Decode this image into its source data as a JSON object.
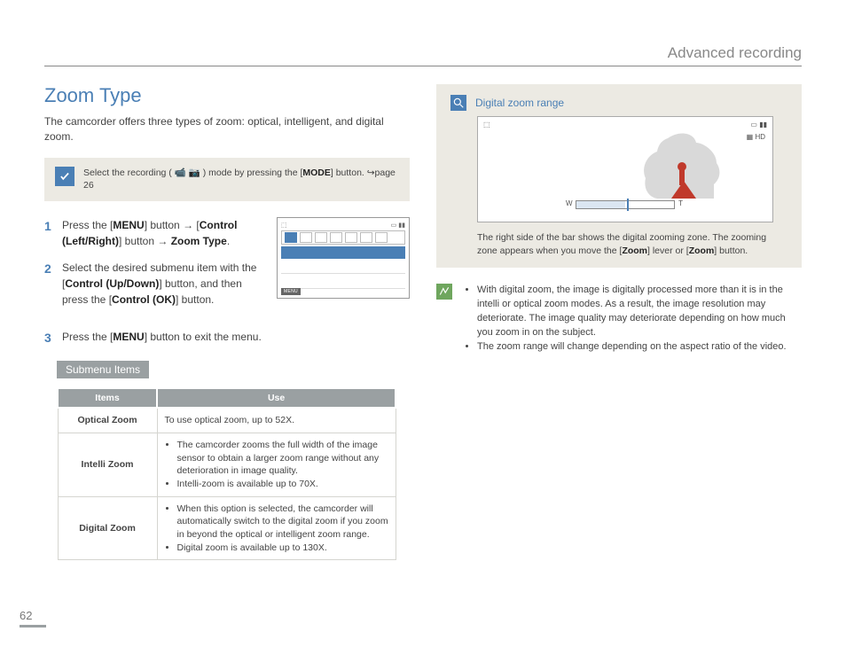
{
  "header": {
    "title": "Advanced recording"
  },
  "section": {
    "title": "Zoom Type",
    "intro": "The camcorder offers three types of zoom: optical, intelligent, and digital zoom."
  },
  "mode_callout": {
    "pre": "Select the recording (",
    "post": ") mode by pressing the [",
    "bold": "MODE",
    "after": "] button. ↪page 26"
  },
  "steps": [
    {
      "parts": [
        "Press the [",
        "MENU",
        "] button → [",
        "Control (Left/Right)",
        "] button → ",
        "Zoom Type",
        "."
      ]
    },
    {
      "parts": [
        "Select the desired submenu item with the [",
        "Control (Up/Down)",
        "] button, and then press the [",
        "Control (OK)",
        "] button."
      ]
    },
    {
      "parts": [
        "Press the [",
        "MENU",
        "] button to exit the menu."
      ]
    }
  ],
  "menu_shot": {
    "footer": "MENU"
  },
  "submenu_header": "Submenu Items",
  "table": {
    "headers": [
      "Items",
      "Use"
    ],
    "rows": [
      {
        "item": "Optical Zoom",
        "use_text": "To use optical zoom, up to 52X."
      },
      {
        "item": "Intelli Zoom",
        "use_list": [
          "The camcorder zooms the full width of the image sensor to obtain a larger zoom range without any deterioration in image quality.",
          "Intelli-zoom is available up to 70X."
        ]
      },
      {
        "item": "Digital Zoom",
        "use_list": [
          "When this option is selected, the camcorder will automatically switch to the digital zoom if you zoom in beyond the optical or intelligent zoom range.",
          "Digital zoom is available up to 130X."
        ]
      }
    ]
  },
  "zoom_panel": {
    "title": "Digital zoom range",
    "caption_pre": "The right side of the bar shows the digital zooming zone. The zooming zone appears when you move the [",
    "caption_b1": "Zoom",
    "caption_mid": "] lever or [",
    "caption_b2": "Zoom",
    "caption_post": "] button."
  },
  "notes": [
    "With digital zoom, the image is digitally processed more than it is in the intelli or optical zoom modes. As a result, the image resolution may deteriorate. The image quality may deteriorate depending on how much you zoom in on the subject.",
    "The zoom range will change depending on the aspect ratio of the video."
  ],
  "page_number": "62"
}
